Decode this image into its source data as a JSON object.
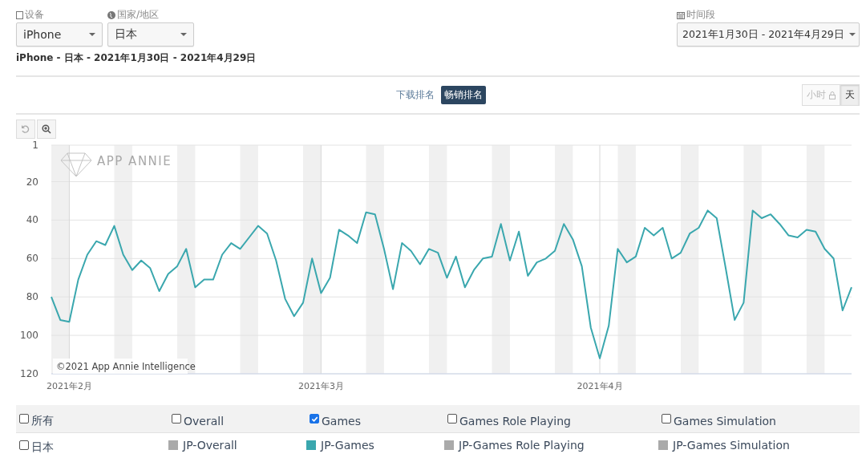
{
  "filters": [
    {
      "kind": "device",
      "label": "设备",
      "value": "iPhone"
    },
    {
      "kind": "country",
      "label": "国家/地区",
      "value": "日本"
    }
  ],
  "date_range": {
    "label": "时间段",
    "value": "2021年1月30日 - 2021年4月29日"
  },
  "summary": "iPhone - 日本 - 2021年1月30日 - 2021年4月29日",
  "ranking_tabs": [
    {
      "label": "下载排名",
      "selected": false
    },
    {
      "label": "畅销排名",
      "selected": true
    }
  ],
  "granularity": [
    {
      "label": "小时",
      "selected": false,
      "disabled": true
    },
    {
      "label": "天",
      "selected": true,
      "disabled": false
    }
  ],
  "chart_logo": "APP ANNIE",
  "credit": "©2021 App Annie Intelligence",
  "chart_data": {
    "type": "line",
    "grid": true,
    "ylim": [
      120,
      1
    ],
    "categories": [
      null,
      null,
      "2021年2月",
      null,
      null,
      null,
      null,
      null,
      null,
      null,
      null,
      null,
      null,
      null,
      null,
      null,
      null,
      null,
      null,
      null,
      null,
      null,
      null,
      null,
      null,
      null,
      null,
      null,
      null,
      null,
      "2021年3月",
      null,
      null,
      null,
      null,
      null,
      null,
      null,
      null,
      null,
      null,
      null,
      null,
      null,
      null,
      null,
      null,
      null,
      null,
      null,
      null,
      null,
      null,
      null,
      null,
      null,
      null,
      null,
      null,
      null,
      null,
      "2021年4月",
      null,
      null,
      null,
      null,
      null,
      null,
      null,
      null,
      null,
      null,
      null,
      null,
      null,
      null,
      null,
      null,
      null,
      null,
      null,
      null,
      null,
      null,
      null,
      null,
      null,
      null,
      null,
      null
    ],
    "yticks": [
      1,
      20,
      40,
      60,
      80,
      100,
      120
    ],
    "series": [
      {
        "name": "JP-Games",
        "color": "#3aa7ae",
        "values": [
          80,
          92,
          93,
          71,
          58,
          51,
          53,
          43,
          58,
          66,
          61,
          65,
          77,
          68,
          64,
          55,
          75,
          71,
          71,
          58,
          52,
          55,
          49,
          43,
          47,
          61,
          81,
          90,
          83,
          60,
          78,
          70,
          45,
          48,
          52,
          36,
          37,
          55,
          76,
          52,
          56,
          63,
          55,
          57,
          70,
          59,
          75,
          66,
          60,
          59,
          42,
          61,
          46,
          69,
          62,
          60,
          56,
          42,
          50,
          64,
          96,
          112,
          95,
          55,
          62,
          59,
          44,
          48,
          44,
          60,
          57,
          47,
          44,
          35,
          39,
          65,
          92,
          83,
          35,
          39,
          37,
          42,
          48,
          49,
          45,
          46,
          55,
          60,
          87,
          75
        ]
      }
    ]
  },
  "legend": {
    "categories": [
      {
        "label": "所有",
        "checked": false
      },
      {
        "label": "Overall",
        "checked": false
      },
      {
        "label": "Games",
        "checked": true
      },
      {
        "label": "Games Role Playing",
        "checked": false
      },
      {
        "label": "Games Simulation",
        "checked": false
      }
    ],
    "series": [
      {
        "kind": "inactive",
        "label": "JP-Overall",
        "color": "#aaaaaa"
      },
      {
        "kind": "chart_series"
      },
      {
        "kind": "inactive",
        "label": "JP-Games Role Playing",
        "color": "#aaaaaa"
      },
      {
        "kind": "inactive",
        "label": "JP-Games Simulation",
        "color": "#aaaaaa"
      }
    ],
    "country": {
      "label": "日本",
      "checked": false
    }
  }
}
